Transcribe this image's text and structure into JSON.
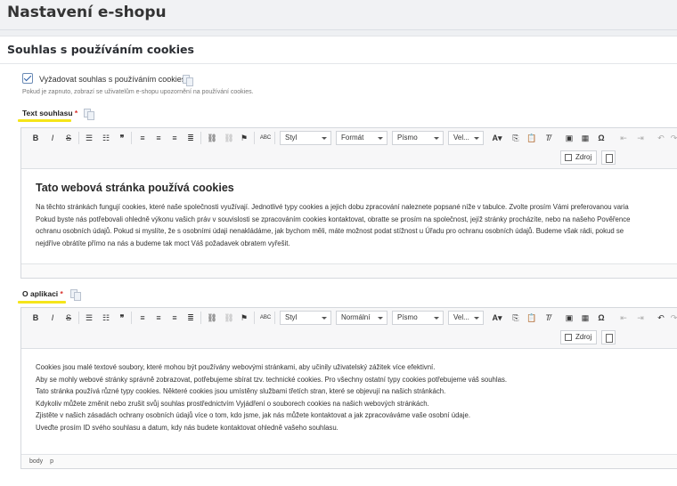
{
  "page": {
    "title": "Nastavení e-shopu"
  },
  "section": {
    "title": "Souhlas s používáním cookies"
  },
  "consent": {
    "checkbox_label": "Vyžadovat souhlas s používáním cookies",
    "checked": true,
    "hint": "Pokud je zapnuto, zobrazí se uživatelům e-shopu upozornění na používání cookies."
  },
  "fields": {
    "text_label": "Text souhlasu",
    "about_label": "O aplikaci",
    "required_mark": "*"
  },
  "toolbar1": {
    "style_combo": "Styl",
    "format_combo": "Formát",
    "font_combo": "Písmo",
    "size_combo": "Vel...",
    "source_button": "Zdroj"
  },
  "toolbar2": {
    "style_combo": "Styl",
    "format_combo": "Normální",
    "font_combo": "Písmo",
    "size_combo": "Vel...",
    "source_button": "Zdroj"
  },
  "editor1": {
    "heading": "Tato webová stránka používá cookies",
    "lines": [
      "Na těchto stránkách fungují cookies, které naše společnosti využívají. Jednotlivé typy cookies a jejich dobu zpracování naleznete popsané níže v  tabulce. Zvolte prosím Vámi preferovanou varia",
      "Pokud byste nás potřebovali ohledně výkonu vašich práv v  souvislosti se zpracováním cookies kontaktovat, obratte se prosím na společnost, jejíž stránky procházíte, nebo na našeho Pověřence",
      "ochranu osobních údajů. Pokud si myslíte, že s  osobními údaji nenakládáme, jak bychom měli, máte možnost podat stížnost u Úřadu pro ochranu osobních údajů. Budeme však rádi, pokud se",
      "nejdříve obrátíte přímo na nás a budeme tak moct Váš požadavek obratem vyřešit."
    ]
  },
  "editor2": {
    "lines": [
      "Cookies jsou malé textové soubory, které mohou být používány webovými stránkami, aby učinily uživatelský zážitek více efektivní.",
      "Aby se mohly webové stránky správně zobrazovat, potřebujeme sbírat tzv. technické cookies. Pro všechny ostatní typy cookies potřebujeme váš souhlas.",
      "Tato stránka používá různé typy cookies. Některé cookies jsou umístěny službami třetích stran, které se objevují na našich stránkách.",
      "Kdykoliv můžete změnit nebo zrušit svůj souhlas prostřednictvím Vyjádření o souborech cookies na našich webových stránkách.",
      "Zjistěte v našich zásadách ochrany osobních údajů více o tom, kdo jsme, jak nás můžete kontaktovat a jak zpracováváme vaše osobní údaje.",
      "Uveďte prosím ID svého souhlasu a datum, kdy nás budete kontaktovat ohledně vašeho souhlasu."
    ],
    "path": [
      "body",
      "p"
    ]
  }
}
